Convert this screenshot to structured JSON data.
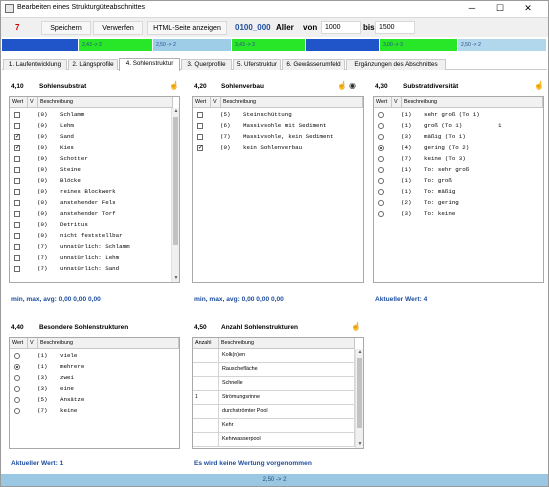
{
  "window": {
    "title": "Bearbeiten eines Strukturgüteabschnittes",
    "controls": {
      "minimize": "─",
      "maximize": "☐",
      "close": "✕"
    }
  },
  "toolbar": {
    "count": "7",
    "save_label": "Speichern",
    "discard_label": "Verwerfen",
    "html_label": "HTML-Seite anzeigen",
    "id_value": "0100_000",
    "river_name": "Aller",
    "from_label": "von",
    "from_value": "1000",
    "to_label": "bis",
    "to_value": "1500"
  },
  "segments": [
    {
      "label": "",
      "color": "#1f55c9"
    },
    {
      "label": "2,43 -> 2",
      "color": "#28e628"
    },
    {
      "label": "2,50 -> 2",
      "color": "#9ecde8"
    },
    {
      "label": "3,43 -> 3",
      "color": "#28e628"
    },
    {
      "label": "",
      "color": "#1f55c9"
    },
    {
      "label": "3,00 -> 3",
      "color": "#28e628"
    },
    {
      "label": "2,50 -> 2",
      "color": "#b0d7ec"
    }
  ],
  "tabs": [
    {
      "label": "1. Laufentwicklung",
      "active": false
    },
    {
      "label": "2. Längsprofile",
      "active": false
    },
    {
      "label": "4. Sohlenstruktur",
      "active": true
    },
    {
      "label": "3. Querprofile",
      "active": false
    },
    {
      "label": "5. Uferstruktur",
      "active": false
    },
    {
      "label": "6. Gewässerumfeld",
      "active": false
    },
    {
      "label": "Ergänzungen des Abschnittes",
      "active": false
    }
  ],
  "col_headers": {
    "wert": "Wert",
    "v": "V",
    "beschreibung": "Beschreibung",
    "anzahl": "Anzahl"
  },
  "sohlensubstrat": {
    "num": "4,10",
    "title": "Sohlensubstrat",
    "rows": [
      {
        "v": "(0)",
        "text": "Schlamm",
        "checked": false
      },
      {
        "v": "(0)",
        "text": "Lehm",
        "checked": false
      },
      {
        "v": "(0)",
        "text": "Sand",
        "checked": true
      },
      {
        "v": "(0)",
        "text": "Kies",
        "checked": true
      },
      {
        "v": "(0)",
        "text": "Schotter",
        "checked": false
      },
      {
        "v": "(0)",
        "text": "Steine",
        "checked": false
      },
      {
        "v": "(0)",
        "text": "Blöcke",
        "checked": false
      },
      {
        "v": "(0)",
        "text": "reines Blockwerk",
        "checked": false
      },
      {
        "v": "(0)",
        "text": "anstehender Fels",
        "checked": false
      },
      {
        "v": "(0)",
        "text": "anstehender Torf",
        "checked": false
      },
      {
        "v": "(0)",
        "text": "Detritus",
        "checked": false
      },
      {
        "v": "(0)",
        "text": "nicht feststellbar",
        "checked": false
      },
      {
        "v": "(7)",
        "text": "unnatürlich: Schlamm",
        "checked": false
      },
      {
        "v": "(7)",
        "text": "unnatürlich: Lehm",
        "checked": false
      },
      {
        "v": "(7)",
        "text": "unnatürlich: Sand",
        "checked": false
      }
    ],
    "stats": "min, max, avg: 0,00  0,00  0,00"
  },
  "sohlenverbau": {
    "num": "4,20",
    "title": "Sohlenverbau",
    "rows": [
      {
        "v": "(5)",
        "text": "Steinschüttung",
        "checked": false
      },
      {
        "v": "(6)",
        "text": "Massivsohle mit Sediment",
        "checked": false
      },
      {
        "v": "(7)",
        "text": "Massivsohle, kein Sediment",
        "checked": false
      },
      {
        "v": "(0)",
        "text": "kein Sohlenverbau",
        "checked": true
      }
    ],
    "stats": "min, max, avg: 0,00  0,00  0,00"
  },
  "substratdiversitaet": {
    "num": "4,30",
    "title": "Substratdiversität",
    "rows": [
      {
        "v": "(1)",
        "text": "sehr groß (To 1)",
        "selected": false,
        "extra": ""
      },
      {
        "v": "(1)",
        "text": "groß (To 1)",
        "selected": false,
        "extra": "1"
      },
      {
        "v": "(3)",
        "text": "mäßig (To 1)",
        "selected": false,
        "extra": ""
      },
      {
        "v": "(4)",
        "text": "gering (To 2)",
        "selected": true,
        "extra": ""
      },
      {
        "v": "(7)",
        "text": "keine (To 3)",
        "selected": false,
        "extra": ""
      },
      {
        "v": "(1)",
        "text": "To: sehr groß",
        "selected": false,
        "extra": ""
      },
      {
        "v": "(1)",
        "text": "To: groß",
        "selected": false,
        "extra": ""
      },
      {
        "v": "(1)",
        "text": "To: mäßig",
        "selected": false,
        "extra": ""
      },
      {
        "v": "(2)",
        "text": "To: gering",
        "selected": false,
        "extra": ""
      },
      {
        "v": "(3)",
        "text": "To: keine",
        "selected": false,
        "extra": ""
      }
    ],
    "current": "Aktueller Wert: 4"
  },
  "sohlstrukturen": {
    "num": "4,40",
    "title": "Besondere Sohlenstrukturen",
    "rows": [
      {
        "v": "(1)",
        "text": "viele",
        "selected": false
      },
      {
        "v": "(1)",
        "text": "mehrere",
        "selected": true
      },
      {
        "v": "(3)",
        "text": "zwei",
        "selected": false
      },
      {
        "v": "(3)",
        "text": "eine",
        "selected": false
      },
      {
        "v": "(5)",
        "text": "Ansätze",
        "selected": false
      },
      {
        "v": "(7)",
        "text": "keine",
        "selected": false
      }
    ],
    "current": "Aktueller Wert: 1"
  },
  "anzahl": {
    "num": "4,50",
    "title": "Anzahl Sohlenstrukturen",
    "rows": [
      {
        "anzahl": "",
        "text": "Kolk(n)en"
      },
      {
        "anzahl": "",
        "text": "Rauschefläche"
      },
      {
        "anzahl": "",
        "text": "Schnelle"
      },
      {
        "anzahl": "1",
        "text": "Strömungsrinne"
      },
      {
        "anzahl": "",
        "text": "durchströmter Pool"
      },
      {
        "anzahl": "",
        "text": "Kehr"
      },
      {
        "anzahl": "",
        "text": "Kehrwasserpool"
      }
    ],
    "note": "Es wird keine Wertung vorgenommen"
  },
  "status": "2,50 -> 2"
}
